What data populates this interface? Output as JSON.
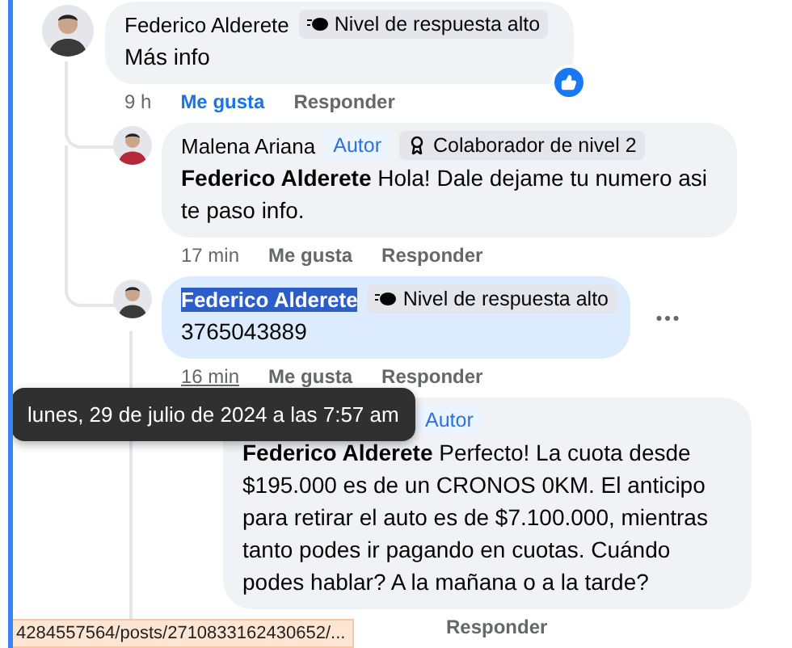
{
  "comments": [
    {
      "author": "Federico Alderete",
      "kind": "man",
      "badges": [
        {
          "kind": "responder",
          "label": "Nivel de respuesta alto"
        }
      ],
      "text": "Más info",
      "time": "9 h",
      "liked": true,
      "reacted": true,
      "highlighted": false,
      "author_selected": false,
      "time_hovered": false,
      "menu_visible": false,
      "like_label": "Me gusta",
      "reply_label": "Responder",
      "replies": [
        {
          "author": "Malena Ariana",
          "kind": "woman",
          "badges": [
            {
              "kind": "author",
              "label": "Autor"
            },
            {
              "kind": "contributor",
              "label": "Colaborador de nivel 2"
            }
          ],
          "mention": "Federico Alderete",
          "text": "Hola! Dale dejame tu numero asi te paso info.",
          "time": "17 min",
          "liked": false,
          "reacted": false,
          "highlighted": false,
          "author_selected": false,
          "time_hovered": false,
          "menu_visible": false,
          "like_label": "Me gusta",
          "reply_label": "Responder"
        },
        {
          "author": "Federico Alderete",
          "kind": "man",
          "badges": [
            {
              "kind": "responder",
              "label": "Nivel de respuesta alto"
            }
          ],
          "text": "3765043889",
          "time": "16 min",
          "liked": false,
          "reacted": false,
          "highlighted": true,
          "author_selected": true,
          "time_hovered": true,
          "menu_visible": true,
          "like_label": "Me gusta",
          "reply_label": "Responder",
          "replies": [
            {
              "badges": [
                {
                  "kind": "author",
                  "label": "Autor"
                }
              ],
              "mention": "Federico Alderete",
              "text": "Perfecto! La cuota desde $195.000 es de un CRONOS 0KM. El anticipo para retirar el auto es de $7.100.000, mientras tanto podes ir pagando en cuotas. Cuándo podes hablar? A la mañana o a la tarde?",
              "highlighted": false,
              "reply_label": "Responder"
            }
          ]
        }
      ]
    }
  ],
  "tooltip": "lunes, 29 de julio de 2024 a las 7:57 am",
  "status_bar": "4284557564/posts/2710833162430652/..."
}
